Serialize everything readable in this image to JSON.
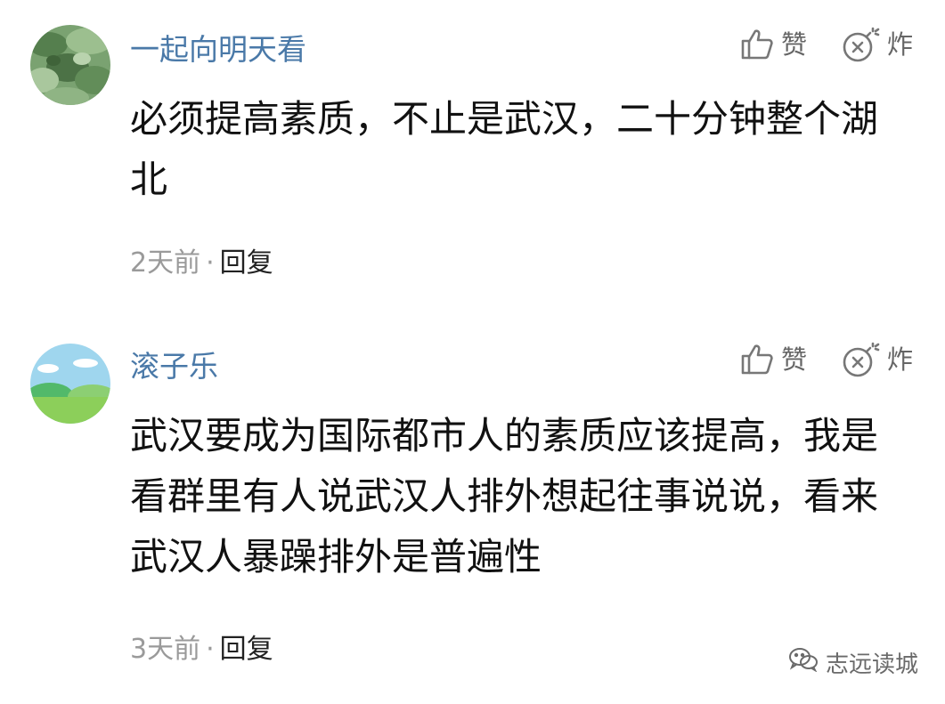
{
  "comments": [
    {
      "username": "一起向明天看",
      "text": "必须提高素质，不止是武汉，二十分钟整个湖北",
      "time": "2天前",
      "separator": "·",
      "reply_label": "回复",
      "like_label": "赞",
      "bomb_label": "炸",
      "avatar": "lotus-leaves-photo"
    },
    {
      "username": "滚子乐",
      "text": "武汉要成为国际都市人的素质应该提高，我是看群里有人说武汉人排外想起往事说说，看来武汉人暴躁排外是普遍性",
      "time": "3天前",
      "separator": "·",
      "reply_label": "回复",
      "like_label": "赞",
      "bomb_label": "炸",
      "avatar": "cartoon-landscape"
    }
  ],
  "watermark": {
    "text": "志远读城",
    "icon": "wechat-icon"
  },
  "colors": {
    "username": "#4a79a8",
    "text": "#111111",
    "meta": "#9a9a9a",
    "icon": "#777777"
  }
}
